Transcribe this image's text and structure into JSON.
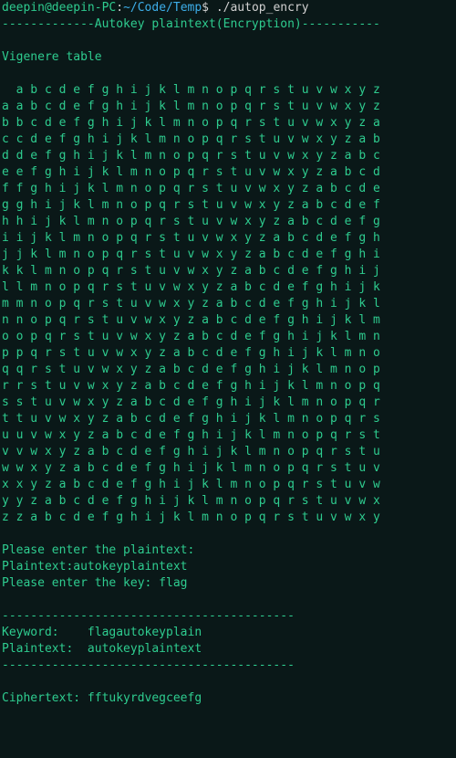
{
  "prompt": {
    "user": "deepin",
    "at": "@",
    "host": "deepin-PC",
    "colon": ":",
    "path": "~/Code/Temp",
    "dollar": "$ ",
    "command": "./autop_encry"
  },
  "header": "-------------Autokey plaintext(Encryption)-----------",
  "tableTitle": "Vigenere table",
  "tableRows": [
    "  a b c d e f g h i j k l m n o p q r s t u v w x y z",
    "a a b c d e f g h i j k l m n o p q r s t u v w x y z",
    "b b c d e f g h i j k l m n o p q r s t u v w x y z a",
    "c c d e f g h i j k l m n o p q r s t u v w x y z a b",
    "d d e f g h i j k l m n o p q r s t u v w x y z a b c",
    "e e f g h i j k l m n o p q r s t u v w x y z a b c d",
    "f f g h i j k l m n o p q r s t u v w x y z a b c d e",
    "g g h i j k l m n o p q r s t u v w x y z a b c d e f",
    "h h i j k l m n o p q r s t u v w x y z a b c d e f g",
    "i i j k l m n o p q r s t u v w x y z a b c d e f g h",
    "j j k l m n o p q r s t u v w x y z a b c d e f g h i",
    "k k l m n o p q r s t u v w x y z a b c d e f g h i j",
    "l l m n o p q r s t u v w x y z a b c d e f g h i j k",
    "m m n o p q r s t u v w x y z a b c d e f g h i j k l",
    "n n o p q r s t u v w x y z a b c d e f g h i j k l m",
    "o o p q r s t u v w x y z a b c d e f g h i j k l m n",
    "p p q r s t u v w x y z a b c d e f g h i j k l m n o",
    "q q r s t u v w x y z a b c d e f g h i j k l m n o p",
    "r r s t u v w x y z a b c d e f g h i j k l m n o p q",
    "s s t u v w x y z a b c d e f g h i j k l m n o p q r",
    "t t u v w x y z a b c d e f g h i j k l m n o p q r s",
    "u u v w x y z a b c d e f g h i j k l m n o p q r s t",
    "v v w x y z a b c d e f g h i j k l m n o p q r s t u",
    "w w x y z a b c d e f g h i j k l m n o p q r s t u v",
    "x x y z a b c d e f g h i j k l m n o p q r s t u v w",
    "y y z a b c d e f g h i j k l m n o p q r s t u v w x",
    "z z a b c d e f g h i j k l m n o p q r s t u v w x y"
  ],
  "plainPrompt": "Please enter the plaintext:",
  "plainLine": "Plaintext:autokeyplaintext",
  "keyPrompt": "Please enter the key: flag",
  "sep1": "-----------------------------------------",
  "keywordLine": "Keyword:    flagautokeyplain",
  "plaintextLine": "Plaintext:  autokeyplaintext",
  "sep2": "-----------------------------------------",
  "cipherLine": "Ciphertext: fftukyrdvegceefg"
}
